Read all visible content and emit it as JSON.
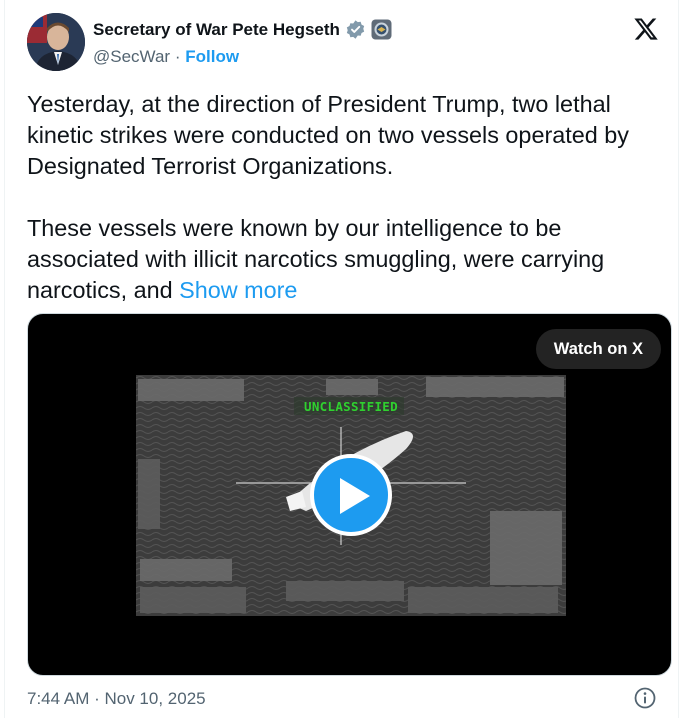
{
  "author": {
    "name": "Secretary of War Pete Hegseth",
    "handle": "@SecWar",
    "separator": "·",
    "follow_label": "Follow"
  },
  "tweet": {
    "paragraph1": "Yesterday, at the direction of President Trump, two lethal kinetic strikes were conducted on two vessels operated by Designated Terrorist Organizations.",
    "paragraph2": "These vessels were known by our intelligence to be associated with illicit narcotics smuggling, were carrying narcotics, and",
    "show_more": "Show more"
  },
  "media": {
    "watch_label": "Watch on X",
    "overlay_text": "UNCLASSIFIED"
  },
  "footer": {
    "timestamp": "7:44 AM · Nov 10, 2025"
  },
  "icons": {
    "verified": "verified-badge-icon",
    "affiliation": "government-seal-icon",
    "brand": "x-logo-icon",
    "play": "play-icon",
    "info": "info-icon"
  },
  "colors": {
    "accent": "#1d9bf0",
    "verified_badge": "#829aab",
    "secondary_text": "#536471",
    "overlay_text": "#2fd12f"
  }
}
